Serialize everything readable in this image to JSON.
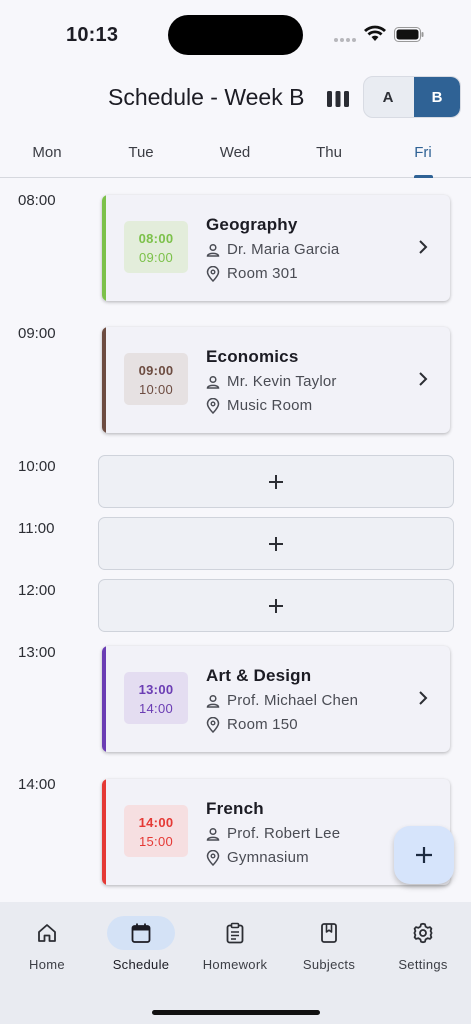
{
  "status": {
    "time": "10:13"
  },
  "header": {
    "title": "Schedule - Week B",
    "week_a": "A",
    "week_b": "B"
  },
  "days": [
    {
      "label": "Mon",
      "active": false
    },
    {
      "label": "Tue",
      "active": false
    },
    {
      "label": "Wed",
      "active": false
    },
    {
      "label": "Thu",
      "active": false
    },
    {
      "label": "Fri",
      "active": true
    }
  ],
  "time_slots": [
    "08:00",
    "09:00",
    "10:00",
    "11:00",
    "12:00",
    "13:00",
    "14:00"
  ],
  "lessons": [
    {
      "subject": "Geography",
      "teacher": "Dr. Maria Garcia",
      "room": "Room 301",
      "start": "08:00",
      "end": "09:00",
      "color": "#7cc14a",
      "chip_bg": "#e3eddb",
      "chip_text": "#7cc14a"
    },
    {
      "subject": "Economics",
      "teacher": "Mr. Kevin Taylor",
      "room": "Music Room",
      "start": "09:00",
      "end": "10:00",
      "color": "#6d4c41",
      "chip_bg": "#e6e1e2",
      "chip_text": "#6d4c41"
    },
    {
      "subject": "Art & Design",
      "teacher": "Prof. Michael Chen",
      "room": "Room 150",
      "start": "13:00",
      "end": "14:00",
      "color": "#6b3db4",
      "chip_bg": "#e4ddf1",
      "chip_text": "#6b3db4"
    },
    {
      "subject": "French",
      "teacher": "Prof. Robert Lee",
      "room": "Gymnasium",
      "start": "14:00",
      "end": "15:00",
      "color": "#e53935",
      "chip_bg": "#f6dfe1",
      "chip_text": "#e53935"
    }
  ],
  "nav": [
    {
      "label": "Home",
      "icon": "home-icon"
    },
    {
      "label": "Schedule",
      "icon": "calendar-icon"
    },
    {
      "label": "Homework",
      "icon": "clipboard-icon"
    },
    {
      "label": "Subjects",
      "icon": "book-icon"
    },
    {
      "label": "Settings",
      "icon": "gear-icon"
    }
  ]
}
